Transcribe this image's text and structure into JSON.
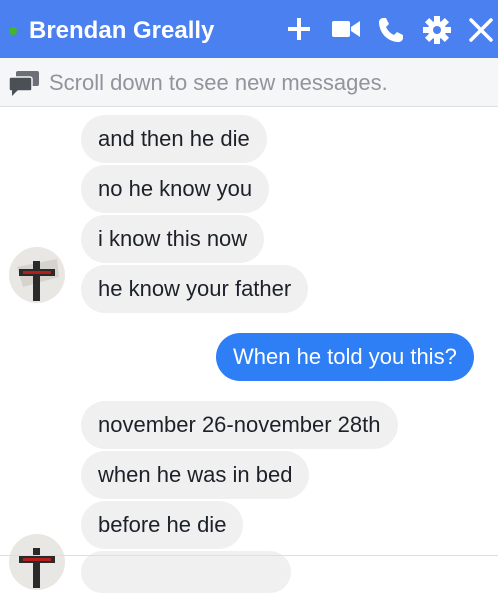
{
  "header": {
    "contact_name": "Brendan Greally",
    "online_color": "#42b72a",
    "bg_color": "#4a80f0",
    "icons": [
      "add-icon",
      "video-icon",
      "phone-icon",
      "gear-icon",
      "close-icon"
    ]
  },
  "notice": {
    "text": "Scroll down to see new messages."
  },
  "messages": [
    {
      "sender": "Brendan Greally",
      "text": "and then he die"
    },
    {
      "sender": "Brendan Greally",
      "text": "no he know you"
    },
    {
      "sender": "Brendan Greally",
      "text": "i know this now"
    },
    {
      "sender": "Brendan Greally",
      "text": "he know your father"
    },
    {
      "sender": "me",
      "text": "When he told you this?"
    },
    {
      "sender": "Brendan Greally",
      "text": "november 26-november 28th"
    },
    {
      "sender": "Brendan Greally",
      "text": "when he was in bed"
    },
    {
      "sender": "Brendan Greally",
      "text": "before he die"
    }
  ],
  "colors": {
    "incoming_bubble": "#f1f0f0",
    "outgoing_bubble": "#2e7ff6"
  }
}
